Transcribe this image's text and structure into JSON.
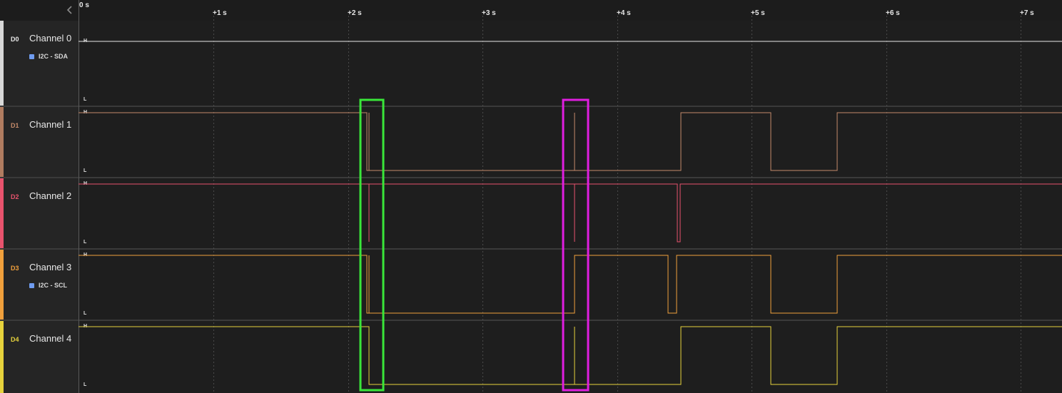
{
  "ruler": {
    "zero": "0 s",
    "ticks": [
      "+1 s",
      "+2 s",
      "+3 s",
      "+4 s",
      "+5 s",
      "+6 s",
      "+7 s"
    ],
    "collapse_icon": "chevron-left-icon"
  },
  "level_labels": {
    "high": "H",
    "low": "L"
  },
  "channels": [
    {
      "code": "D0",
      "name": "Channel 0",
      "color": "#e8e8e8",
      "analyzer": "I2C - SDA"
    },
    {
      "code": "D1",
      "name": "Channel 1",
      "color": "#c48a6a",
      "analyzer": ""
    },
    {
      "code": "D2",
      "name": "Channel 2",
      "color": "#e8536d",
      "analyzer": ""
    },
    {
      "code": "D3",
      "name": "Channel 3",
      "color": "#f0a03c",
      "analyzer": "I2C - SCL"
    },
    {
      "code": "D4",
      "name": "Channel 4",
      "color": "#e6d23c",
      "analyzer": ""
    }
  ],
  "markers": [
    {
      "name": "green-selection-box",
      "color": "#39e639"
    },
    {
      "name": "magenta-selection-box",
      "color": "#e01ee0"
    }
  ]
}
